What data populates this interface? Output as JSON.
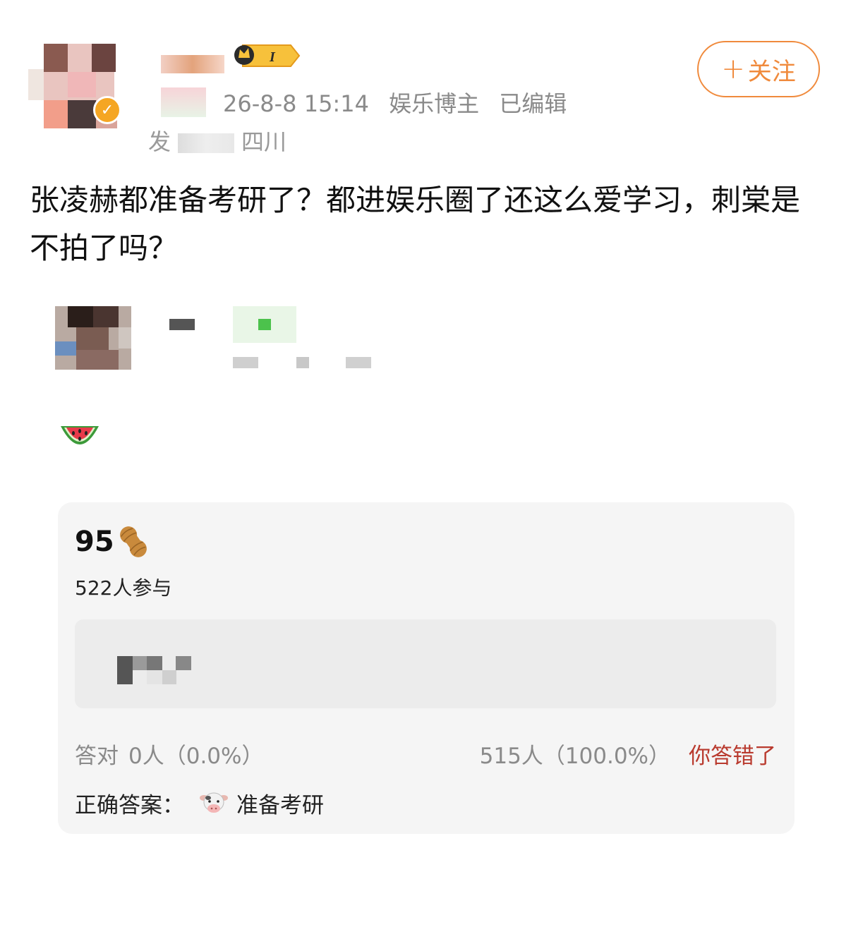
{
  "header": {
    "timestamp": "26-8-8 15:14",
    "role": "娱乐博主",
    "edited": "已编辑",
    "location_prefix": "发",
    "location": "四川",
    "level_badge": "I",
    "verified_icon": "verified-check-icon"
  },
  "follow": {
    "label": "关注",
    "plus": "+"
  },
  "post": {
    "text": "张凌赫都准备考研了？都进娱乐圈了还这么爱学习，刺棠是不拍了吗？"
  },
  "repost": {
    "emoji": "watermelon-icon"
  },
  "quiz": {
    "score": "95",
    "score_icon": "peanut-icon",
    "participants": "522人参与",
    "correct_label": "答对",
    "correct_stats": "0人（0.0%）",
    "wrong_stats": "515人（100.0%）",
    "result": "你答错了",
    "answer_label": "正确答案：",
    "answer_icon": "cow-icon",
    "answer_text": "准备考研"
  },
  "colors": {
    "accent": "#f08a3c",
    "wrong": "#b93a2e",
    "muted": "#8a8a8a",
    "card_bg": "#f5f5f5"
  }
}
